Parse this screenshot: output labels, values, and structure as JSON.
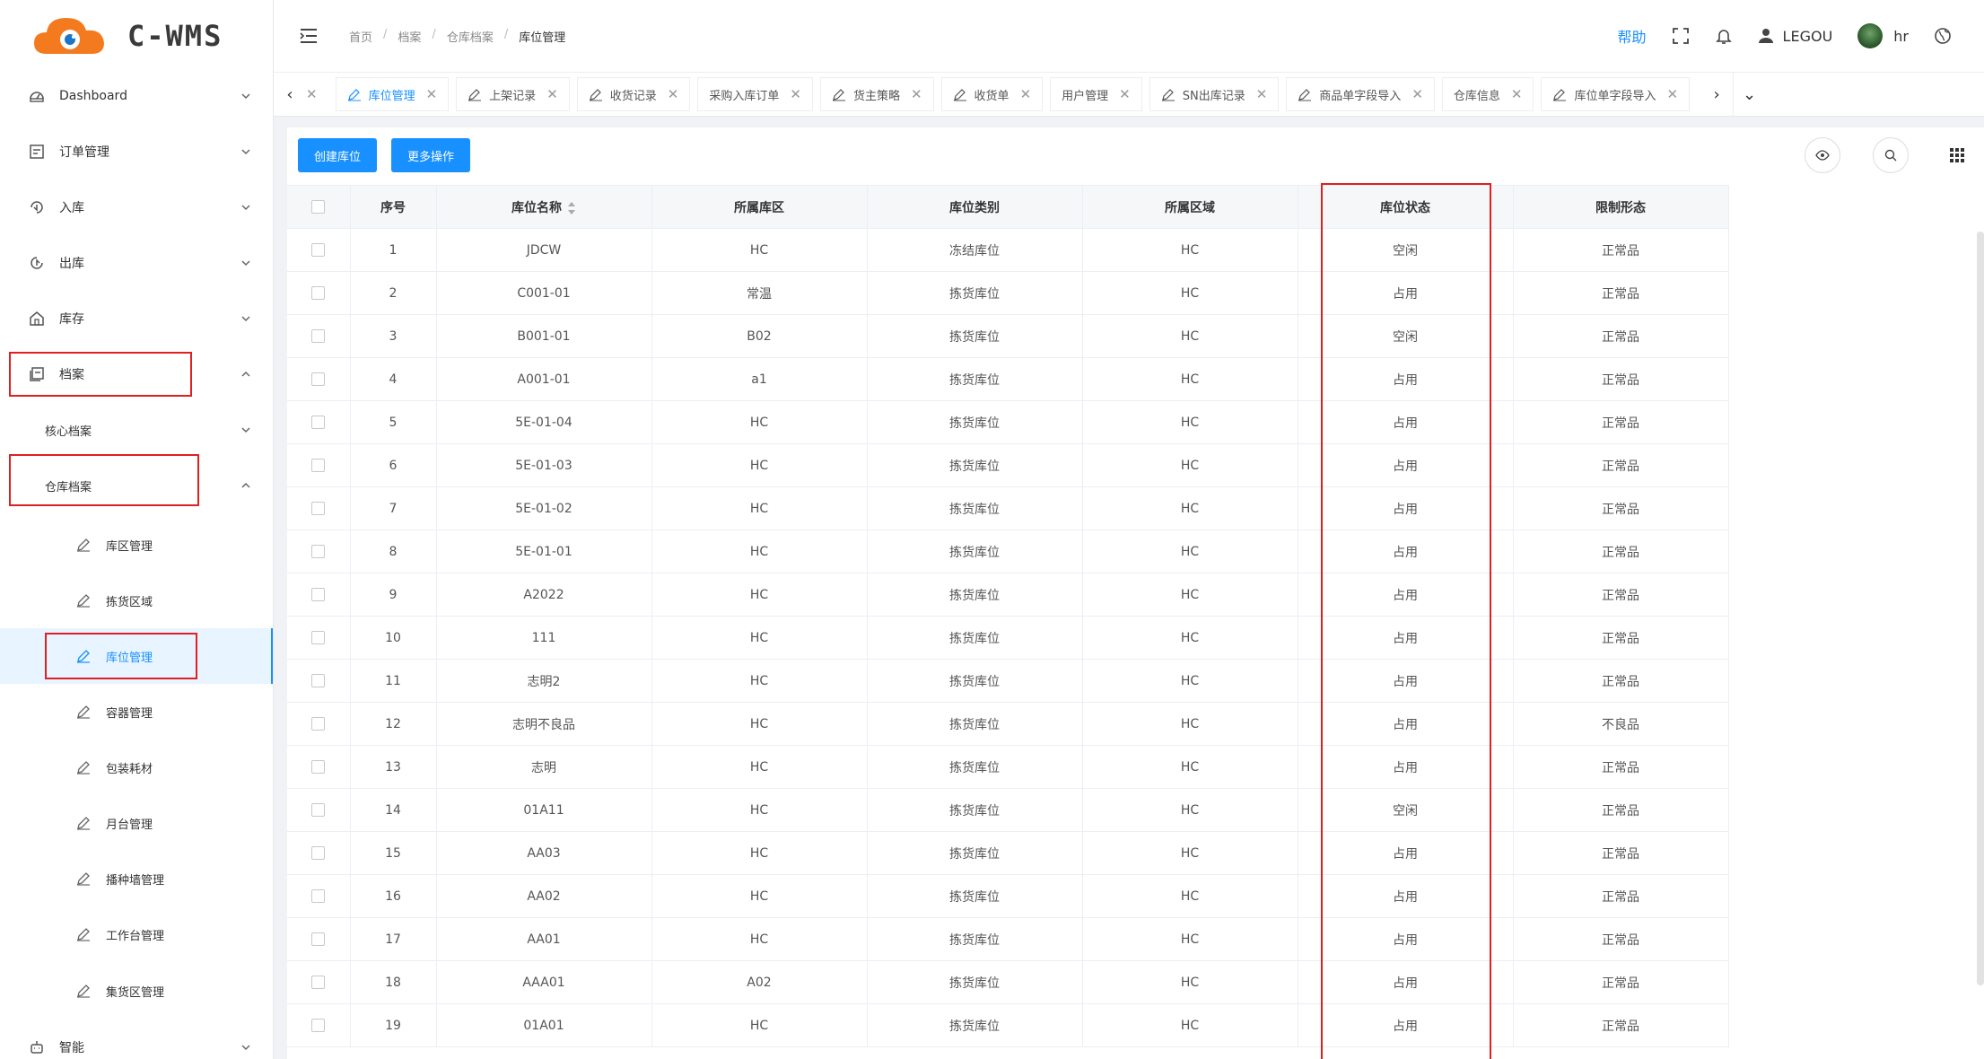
{
  "logo": {
    "text": "C-WMS"
  },
  "sidebar": {
    "items": [
      {
        "label": "Dashboard",
        "icon": "dashboard-icon"
      },
      {
        "label": "订单管理",
        "icon": "order-icon"
      },
      {
        "label": "入库",
        "icon": "inbound-icon"
      },
      {
        "label": "出库",
        "icon": "outbound-icon"
      },
      {
        "label": "库存",
        "icon": "inventory-icon"
      },
      {
        "label": "档案",
        "icon": "archive-icon"
      },
      {
        "label": "核心档案"
      },
      {
        "label": "仓库档案"
      },
      {
        "label": "库区管理",
        "icon": "edit-icon"
      },
      {
        "label": "拣货区域",
        "icon": "edit-icon"
      },
      {
        "label": "库位管理",
        "icon": "edit-icon"
      },
      {
        "label": "容器管理",
        "icon": "edit-icon"
      },
      {
        "label": "包装耗材",
        "icon": "edit-icon"
      },
      {
        "label": "月台管理",
        "icon": "edit-icon"
      },
      {
        "label": "播种墙管理",
        "icon": "edit-icon"
      },
      {
        "label": "工作台管理",
        "icon": "edit-icon"
      },
      {
        "label": "集货区管理",
        "icon": "edit-icon"
      },
      {
        "label": "智能",
        "icon": "smart-icon"
      }
    ]
  },
  "breadcrumb": [
    "首页",
    "档案",
    "仓库档案",
    "库位管理"
  ],
  "header": {
    "help": "帮助",
    "org": "LEGOU",
    "user": "hr"
  },
  "tabs": [
    {
      "label": "库位管理"
    },
    {
      "label": "上架记录"
    },
    {
      "label": "收货记录"
    },
    {
      "label": "采购入库订单"
    },
    {
      "label": "货主策略"
    },
    {
      "label": "收货单"
    },
    {
      "label": "用户管理"
    },
    {
      "label": "SN出库记录"
    },
    {
      "label": "商品单字段导入"
    },
    {
      "label": "仓库信息"
    },
    {
      "label": "库位单字段导入"
    }
  ],
  "toolbar": {
    "create_label": "创建库位",
    "more_label": "更多操作"
  },
  "table": {
    "headers": [
      "序号",
      "库位名称",
      "所属库区",
      "库位类别",
      "所属区域",
      "库位状态",
      "限制形态"
    ],
    "rows": [
      [
        "1",
        "JDCW",
        "HC",
        "冻结库位",
        "HC",
        "空闲",
        "正常品"
      ],
      [
        "2",
        "C001-01",
        "常温",
        "拣货库位",
        "HC",
        "占用",
        "正常品"
      ],
      [
        "3",
        "B001-01",
        "B02",
        "拣货库位",
        "HC",
        "空闲",
        "正常品"
      ],
      [
        "4",
        "A001-01",
        "a1",
        "拣货库位",
        "HC",
        "占用",
        "正常品"
      ],
      [
        "5",
        "5E-01-04",
        "HC",
        "拣货库位",
        "HC",
        "占用",
        "正常品"
      ],
      [
        "6",
        "5E-01-03",
        "HC",
        "拣货库位",
        "HC",
        "占用",
        "正常品"
      ],
      [
        "7",
        "5E-01-02",
        "HC",
        "拣货库位",
        "HC",
        "占用",
        "正常品"
      ],
      [
        "8",
        "5E-01-01",
        "HC",
        "拣货库位",
        "HC",
        "占用",
        "正常品"
      ],
      [
        "9",
        "A2022",
        "HC",
        "拣货库位",
        "HC",
        "占用",
        "正常品"
      ],
      [
        "10",
        "111",
        "HC",
        "拣货库位",
        "HC",
        "占用",
        "正常品"
      ],
      [
        "11",
        "志明2",
        "HC",
        "拣货库位",
        "HC",
        "占用",
        "正常品"
      ],
      [
        "12",
        "志明不良品",
        "HC",
        "拣货库位",
        "HC",
        "占用",
        "不良品"
      ],
      [
        "13",
        "志明",
        "HC",
        "拣货库位",
        "HC",
        "占用",
        "正常品"
      ],
      [
        "14",
        "01A11",
        "HC",
        "拣货库位",
        "HC",
        "空闲",
        "正常品"
      ],
      [
        "15",
        "AA03",
        "HC",
        "拣货库位",
        "HC",
        "占用",
        "正常品"
      ],
      [
        "16",
        "AA02",
        "HC",
        "拣货库位",
        "HC",
        "占用",
        "正常品"
      ],
      [
        "17",
        "AA01",
        "HC",
        "拣货库位",
        "HC",
        "占用",
        "正常品"
      ],
      [
        "18",
        "AAA01",
        "A02",
        "拣货库位",
        "HC",
        "占用",
        "正常品"
      ],
      [
        "19",
        "01A01",
        "HC",
        "拣货库位",
        "HC",
        "占用",
        "正常品"
      ]
    ]
  },
  "colors": {
    "accent": "#1890ff",
    "highlight": "#e02020"
  }
}
